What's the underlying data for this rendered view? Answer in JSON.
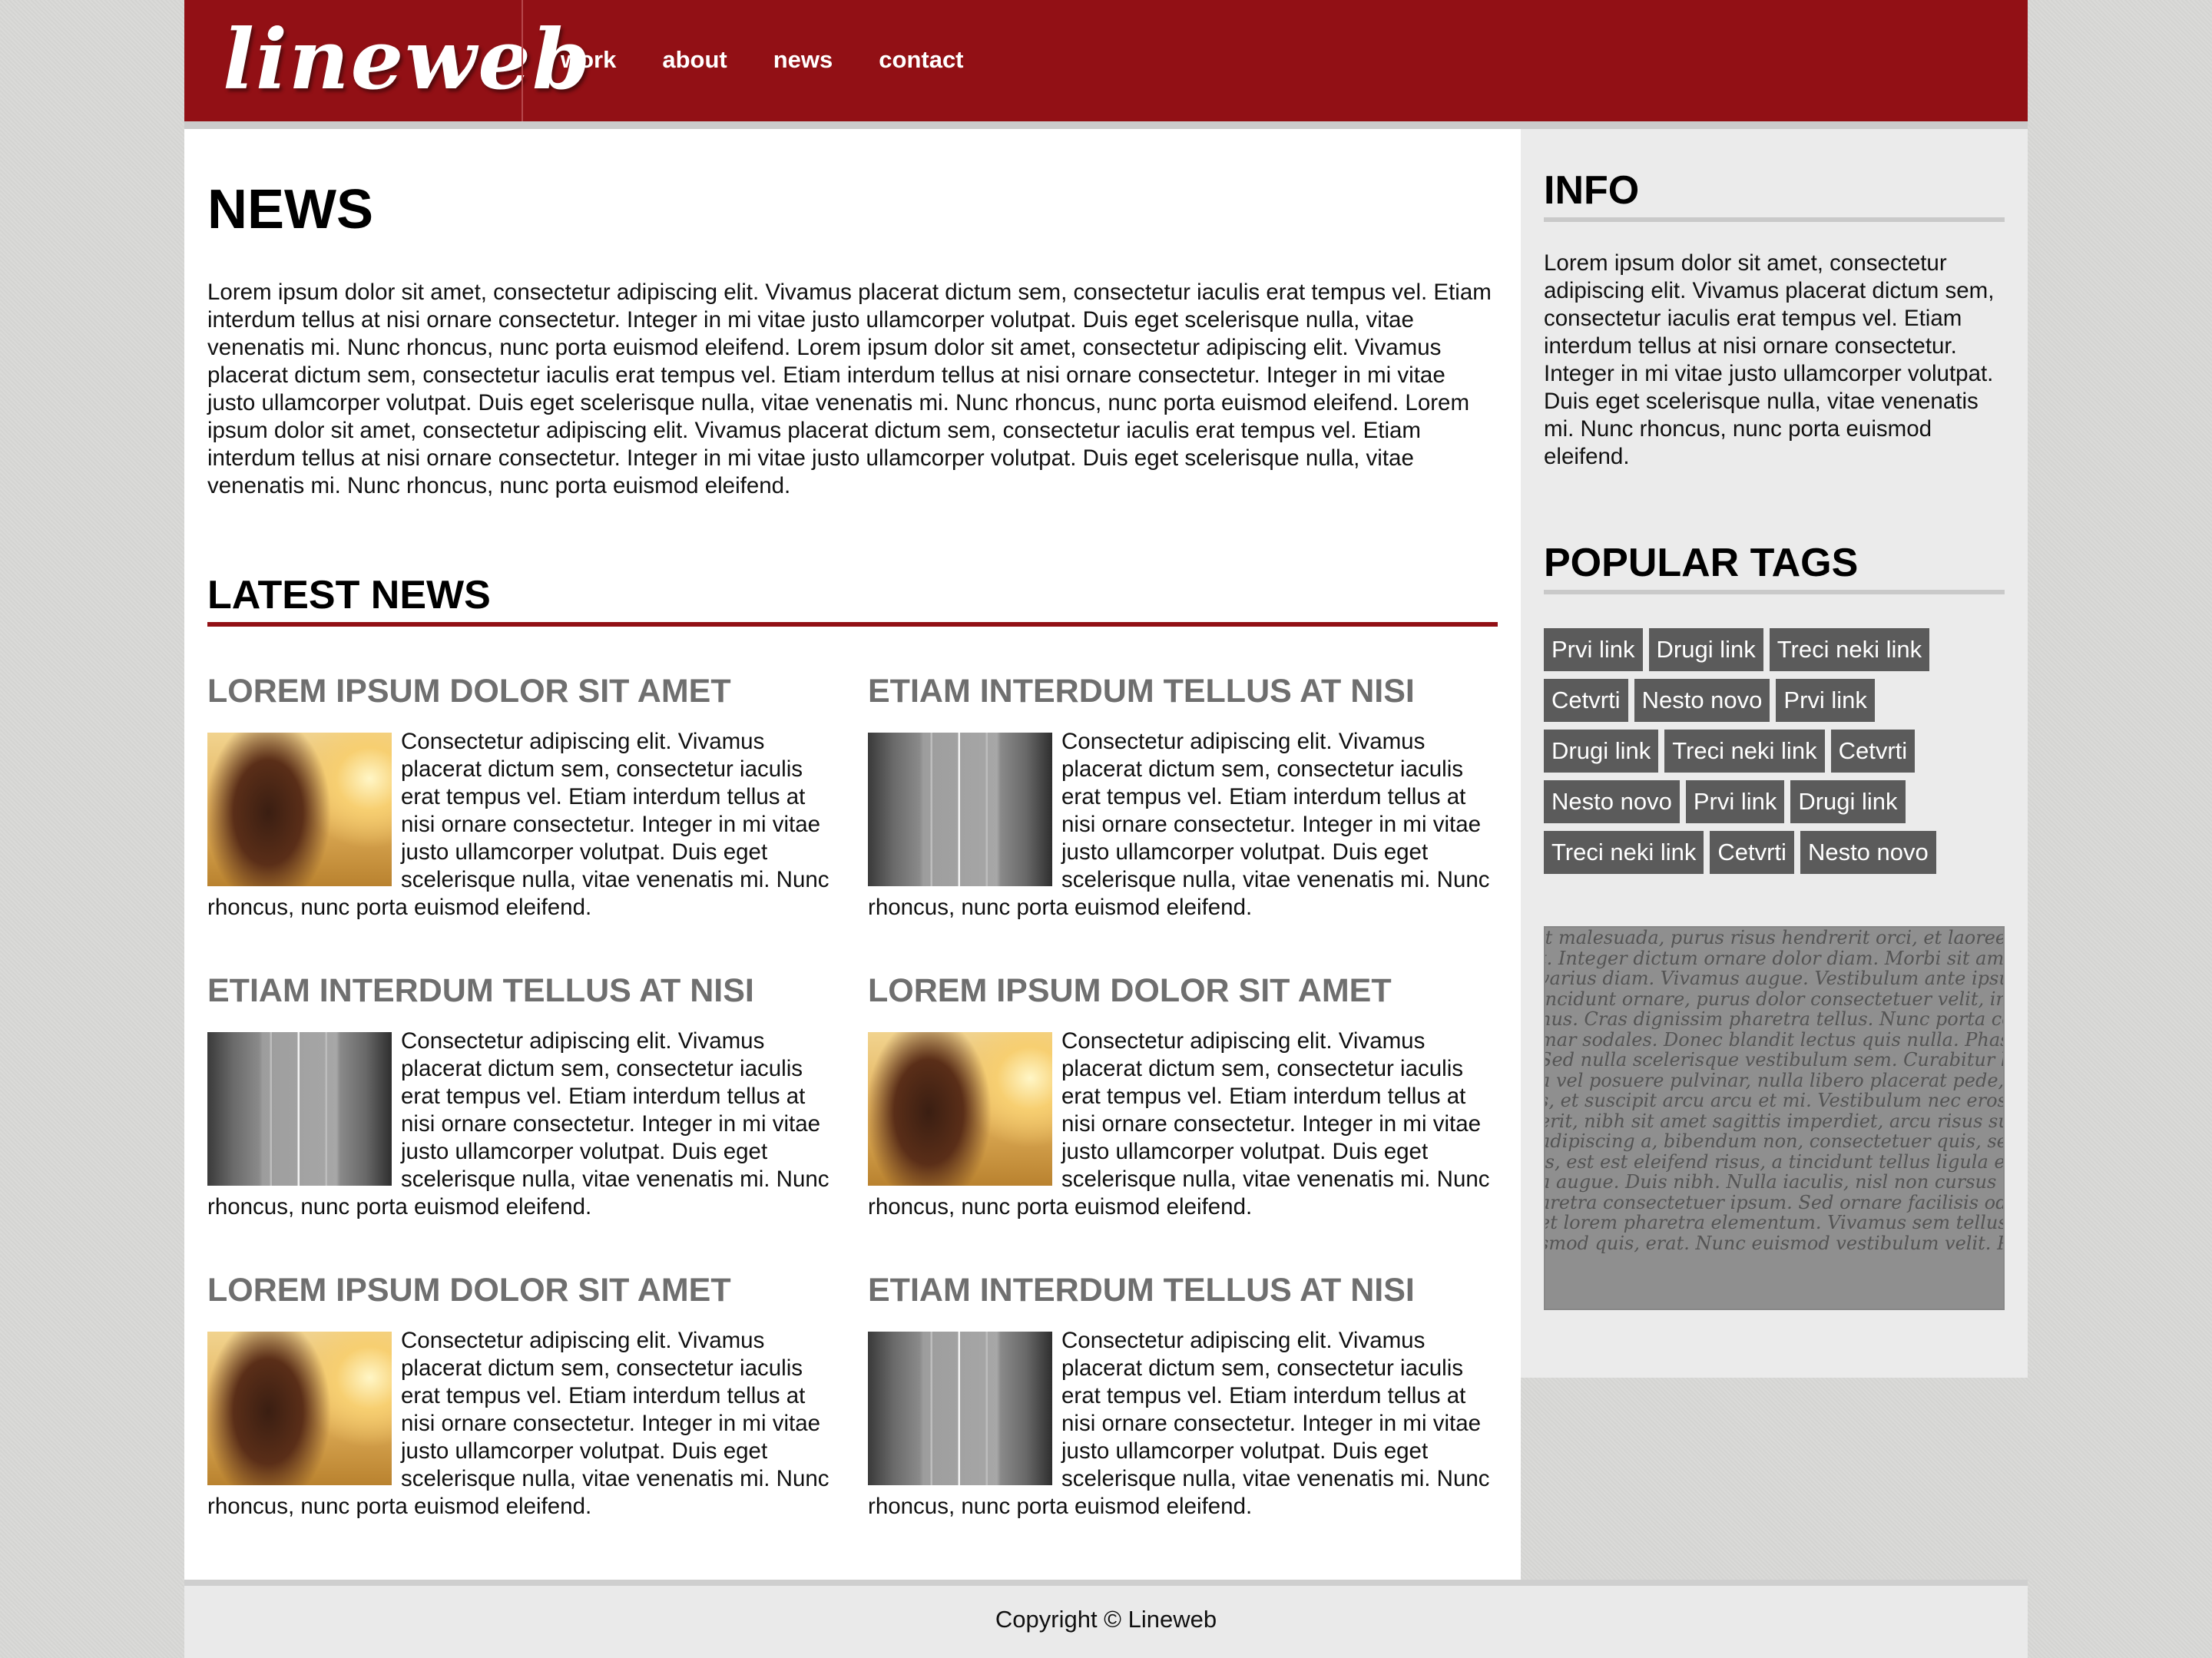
{
  "header": {
    "logo": "lineweb",
    "nav": [
      "work",
      "about",
      "news",
      "contact"
    ]
  },
  "main": {
    "title": "NEWS",
    "intro": "Lorem ipsum dolor sit amet, consectetur adipiscing elit. Vivamus placerat dictum sem, consectetur iaculis erat tempus vel. Etiam interdum tellus at nisi ornare consectetur. Integer in mi vitae justo ullamcorper volutpat. Duis eget scelerisque nulla, vitae venenatis mi. Nunc rhoncus, nunc porta euismod eleifend. Lorem ipsum dolor sit amet, consectetur adipiscing elit. Vivamus placerat dictum sem, consectetur iaculis erat tempus vel. Etiam interdum tellus at nisi ornare consectetur. Integer in mi vitae justo ullamcorper volutpat. Duis eget scelerisque nulla, vitae venenatis mi. Nunc rhoncus, nunc porta euismod eleifend. Lorem ipsum dolor sit amet, consectetur adipiscing elit. Vivamus placerat dictum sem, consectetur iaculis erat tempus vel. Etiam interdum tellus at nisi ornare consectetur. Integer in mi vitae justo ullamcorper volutpat. Duis eget scelerisque nulla, vitae venenatis mi. Nunc rhoncus, nunc porta euismod eleifend.",
    "latest_title": "LATEST NEWS",
    "articles": [
      {
        "title": "LOREM IPSUM DOLOR SIT AMET",
        "image": "girl-in-field-photo",
        "text": "Consectetur adipiscing elit. Vivamus placerat dictum sem, consectetur iaculis erat tempus vel. Etiam interdum tellus at nisi ornare consectetur. Integer in mi vitae justo ullamcorper volutpat. Duis eget scelerisque nulla, vitae venenatis mi. Nunc rhoncus, nunc porta euismod eleifend."
      },
      {
        "title": "ETIAM INTERDUM TELLUS AT NISI",
        "image": "city-road-photo",
        "text": "Consectetur adipiscing elit. Vivamus placerat dictum sem, consectetur iaculis erat tempus vel. Etiam interdum tellus at nisi ornare consectetur. Integer in mi vitae justo ullamcorper volutpat. Duis eget scelerisque nulla, vitae venenatis mi. Nunc rhoncus, nunc porta euismod eleifend."
      },
      {
        "title": "ETIAM INTERDUM TELLUS AT NISI",
        "image": "city-road-photo",
        "text": "Consectetur adipiscing elit. Vivamus placerat dictum sem, consectetur iaculis erat tempus vel. Etiam interdum tellus at nisi ornare consectetur. Integer in mi vitae justo ullamcorper volutpat. Duis eget scelerisque nulla, vitae venenatis mi. Nunc rhoncus, nunc porta euismod eleifend."
      },
      {
        "title": "LOREM IPSUM DOLOR SIT AMET",
        "image": "girl-in-field-photo",
        "text": "Consectetur adipiscing elit. Vivamus placerat dictum sem, consectetur iaculis erat tempus vel. Etiam interdum tellus at nisi ornare consectetur. Integer in mi vitae justo ullamcorper volutpat. Duis eget scelerisque nulla, vitae venenatis mi. Nunc rhoncus, nunc porta euismod eleifend."
      },
      {
        "title": "LOREM IPSUM DOLOR SIT AMET",
        "image": "girl-in-field-photo",
        "text": "Consectetur adipiscing elit. Vivamus placerat dictum sem, consectetur iaculis erat tempus vel. Etiam interdum tellus at nisi ornare consectetur. Integer in mi vitae justo ullamcorper volutpat. Duis eget scelerisque nulla, vitae venenatis mi. Nunc rhoncus, nunc porta euismod eleifend."
      },
      {
        "title": "ETIAM INTERDUM TELLUS AT NISI",
        "image": "city-road-photo",
        "text": "Consectetur adipiscing elit. Vivamus placerat dictum sem, consectetur iaculis erat tempus vel. Etiam interdum tellus at nisi ornare consectetur. Integer in mi vitae justo ullamcorper volutpat. Duis eget scelerisque nulla, vitae venenatis mi. Nunc rhoncus, nunc porta euismod eleifend."
      }
    ]
  },
  "sidebar": {
    "info_title": "INFO",
    "info_text": "Lorem ipsum dolor sit amet, consectetur adipiscing elit. Vivamus placerat dictum sem, consectetur iaculis erat tempus vel. Etiam interdum tellus at nisi ornare consectetur. Integer in mi vitae justo ullamcorper volutpat. Duis eget scelerisque nulla, vitae venenatis mi. Nunc rhoncus, nunc porta euismod eleifend.",
    "tags_title": "POPULAR TAGS",
    "tag_rows": [
      [
        "Prvi link",
        "Drugi link",
        "Treci neki link"
      ],
      [
        "Cetvrti",
        "Nesto novo",
        "Prvi link"
      ],
      [
        "Drugi link",
        "Treci neki link",
        "Cetvrti"
      ],
      [
        "Nesto novo",
        "Prvi link",
        "Drugi link"
      ],
      [
        "Treci neki link",
        "Cetvrti",
        "Nesto novo"
      ]
    ],
    "script_image_lines": [
      "it malesuada, purus risus hendrerit orci, et laoreet pede en",
      "t. Integer dictum ornare dolor diam. Morbi sit amet arcu r",
      "varius diam. Vivamus augue. Vestibulum ante ipsum pede",
      "incidunt ornare, purus dolor consectetuer velit, in euismod",
      "nus. Cras dignissim pharetra tellus. Nunc porta commodo",
      "mar sodales. Donec blandit lectus quis nulla. Phasellus du",
      "Sed nulla scelerisque vestibulum sem. Curabitur libero n",
      "a vel posuere pulvinar, nulla libero placerat pede, at con",
      "s, et suscipit arcu arcu et mi. Vestibulum nec eros dictum",
      "erit, nibh sit amet sagittis imperdiet, arcu risus suscipit a",
      "adipiscing a, bibendum non, consectetuer quis, sem. Proin",
      "is, est est eleifend risus, a tincidunt tellus ligula et lectus.",
      "a augue. Duis nibh. Nulla iaculis, nisl non cursus iaculis,",
      "aretra consectetuer ipsum. Sed ornare facilisis odio. Cum s",
      "et lorem pharetra elementum. Vivamus sem tellus, digniss",
      "smod quis, erat. Nunc euismod vestibulum velit. Proin un"
    ]
  },
  "footer": {
    "copyright": "Copyright © Lineweb"
  }
}
